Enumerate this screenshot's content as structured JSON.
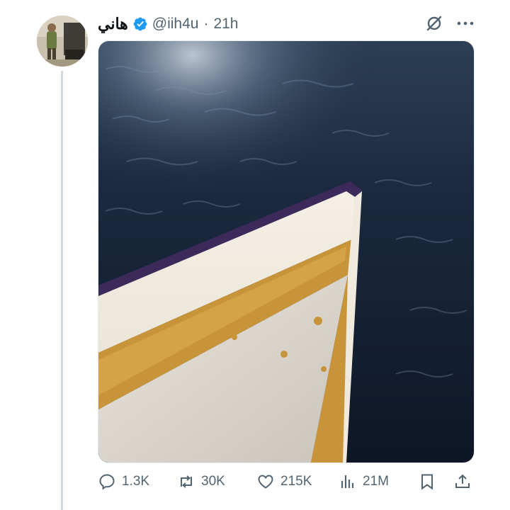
{
  "tweet": {
    "display_name": "هاني",
    "handle": "@iih4u",
    "separator": "·",
    "timestamp": "21h",
    "verified": true
  },
  "actions": {
    "replies": "1.3K",
    "reposts": "30K",
    "likes": "215K",
    "views": "21M"
  },
  "icons": [
    "avatar",
    "verified-badge-icon",
    "grok-icon",
    "more-icon",
    "reply-icon",
    "repost-icon",
    "like-icon",
    "views-icon",
    "bookmark-icon",
    "share-icon"
  ],
  "colors": {
    "text_primary": "#0f1419",
    "text_secondary": "#536471",
    "verified_blue": "#1d9bf0",
    "thread_line": "#cfd9de"
  }
}
